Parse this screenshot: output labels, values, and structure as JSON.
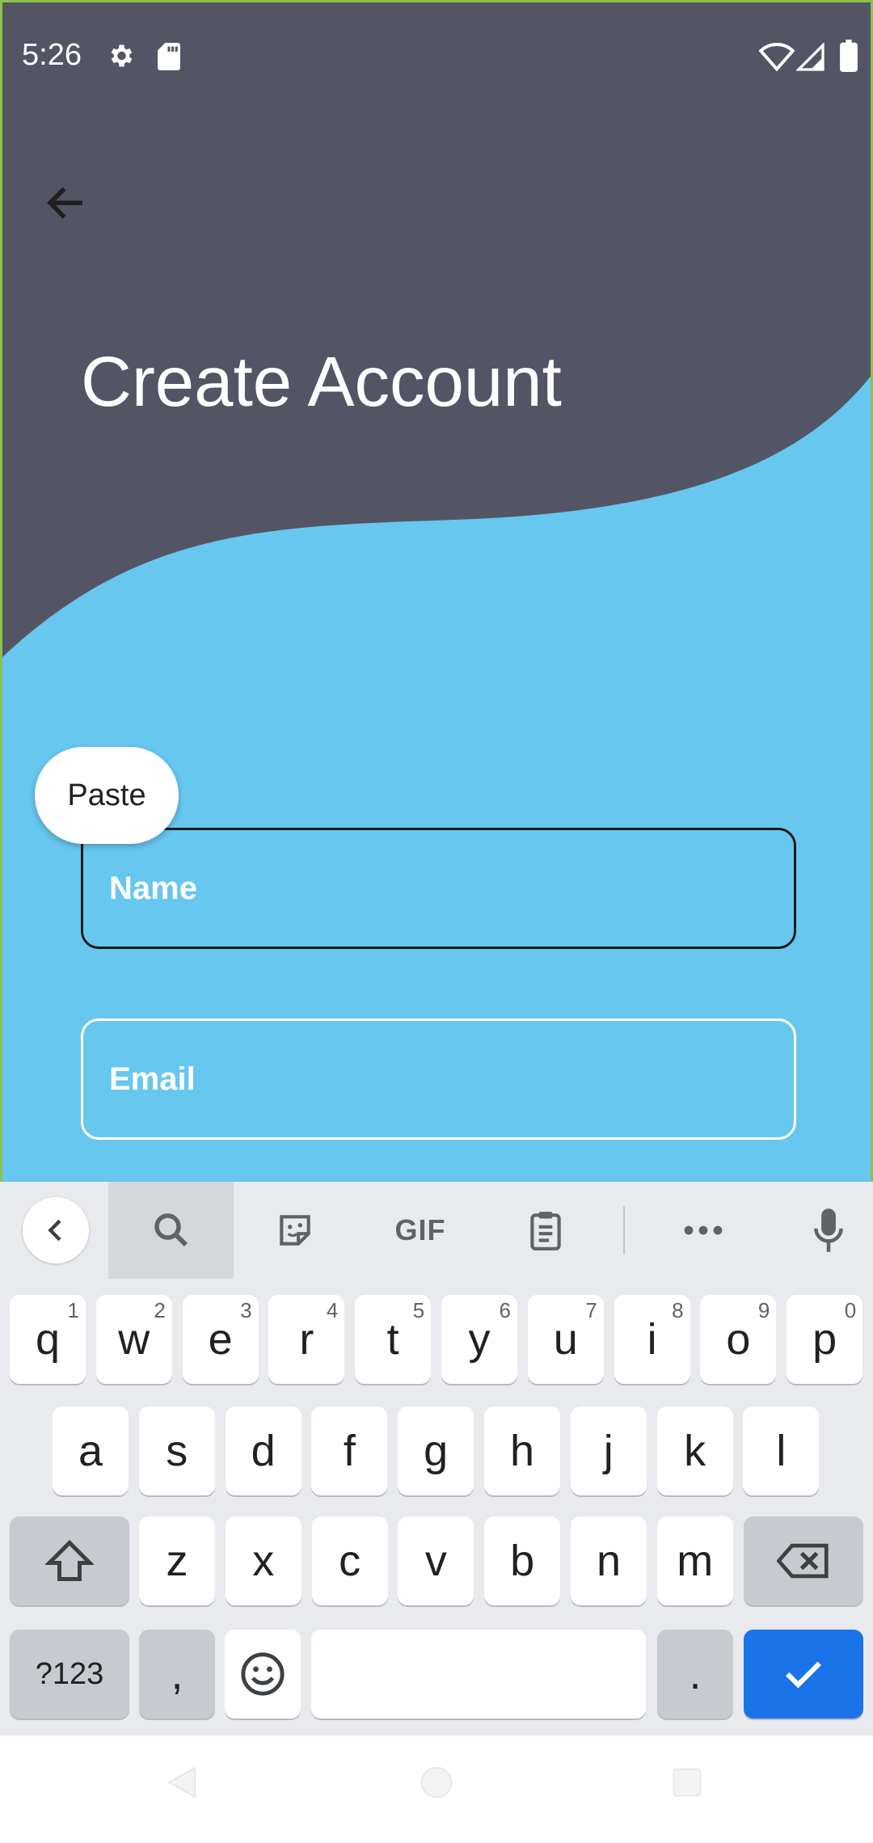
{
  "status_bar": {
    "time": "5:26",
    "icons": [
      "gear-icon",
      "sd-card-icon",
      "wifi-icon",
      "signal-icon",
      "battery-icon"
    ]
  },
  "header": {
    "title": "Create Account"
  },
  "context_menu": {
    "paste_label": "Paste"
  },
  "form": {
    "name_placeholder": "Name",
    "email_placeholder": "Email"
  },
  "keyboard": {
    "toolbar": [
      "back-arrow-icon",
      "search-icon",
      "sticker-icon",
      "GIF",
      "clipboard-icon",
      "more-icon",
      "mic-icon"
    ],
    "gif_label": "GIF",
    "row1": [
      {
        "k": "q",
        "h": "1"
      },
      {
        "k": "w",
        "h": "2"
      },
      {
        "k": "e",
        "h": "3"
      },
      {
        "k": "r",
        "h": "4"
      },
      {
        "k": "t",
        "h": "5"
      },
      {
        "k": "y",
        "h": "6"
      },
      {
        "k": "u",
        "h": "7"
      },
      {
        "k": "i",
        "h": "8"
      },
      {
        "k": "o",
        "h": "9"
      },
      {
        "k": "p",
        "h": "0"
      }
    ],
    "row2": [
      "a",
      "s",
      "d",
      "f",
      "g",
      "h",
      "j",
      "k",
      "l"
    ],
    "row3": [
      "z",
      "x",
      "c",
      "v",
      "b",
      "n",
      "m"
    ],
    "symbols_label": "?123",
    "comma_label": ",",
    "period_label": "."
  },
  "colors": {
    "header_bg": "#535564",
    "body_bg": "#67c7ef",
    "accent": "#1a73e8"
  }
}
